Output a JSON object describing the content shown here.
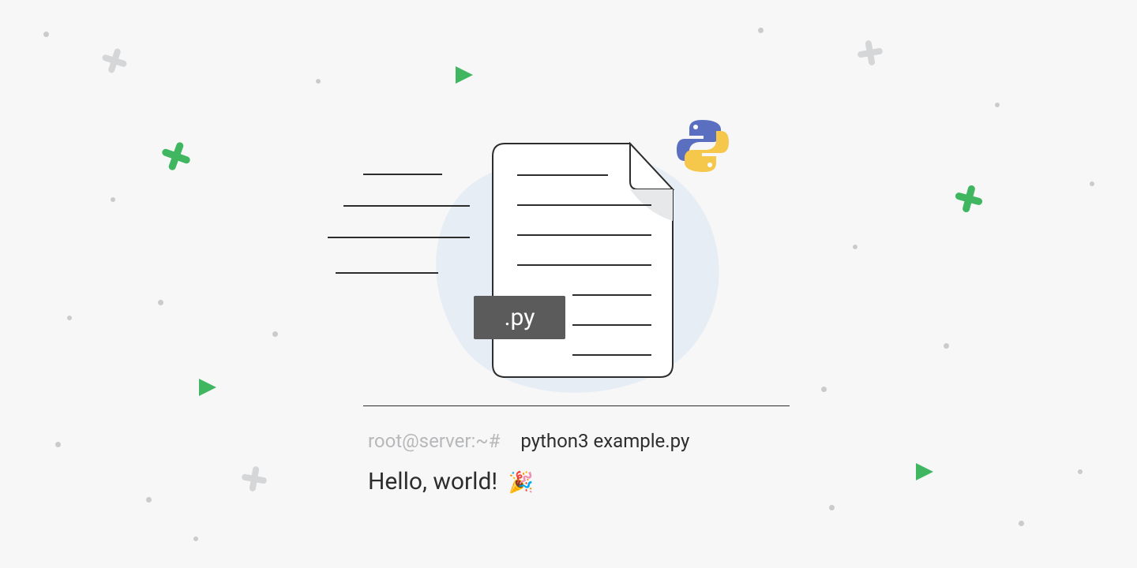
{
  "file": {
    "extension_label": ".py"
  },
  "terminal": {
    "prompt": "root@server:~#",
    "command": "python3 example.py",
    "output": "Hello, world!",
    "emoji": "🎉"
  },
  "colors": {
    "accent_green": "#3fb65f",
    "python_blue": "#5a6fbf",
    "python_yellow": "#f5c84c",
    "soft_gray": "#c9cbcc",
    "pale_blue": "#e6edf5",
    "dark": "#2d2d2d",
    "badge_bg": "#5b5b5b"
  }
}
